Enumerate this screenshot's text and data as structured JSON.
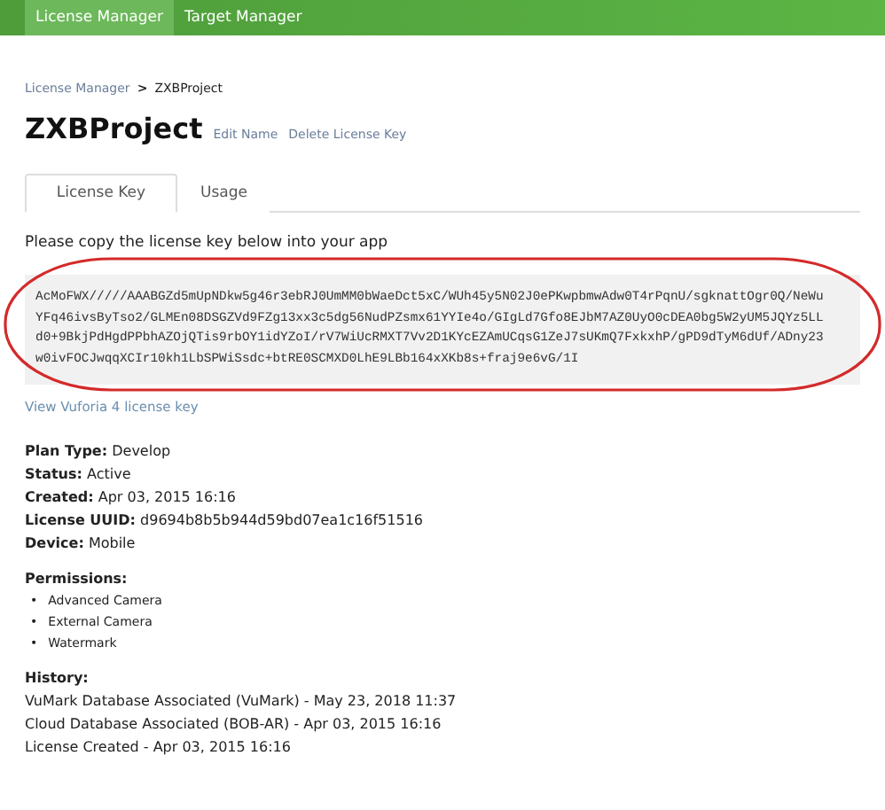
{
  "nav": [
    {
      "label": "License Manager",
      "selected": true
    },
    {
      "label": "Target Manager",
      "selected": false
    }
  ],
  "breadcrumb": [
    {
      "label": "License Manager",
      "link": true
    },
    {
      "label": "ZXBProject",
      "link": false
    }
  ],
  "breadcrumb_separator": ">",
  "title": "ZXBProject",
  "title_actions": [
    "Edit Name",
    "Delete License Key"
  ],
  "tabs": [
    {
      "label": "License Key",
      "selected": true
    },
    {
      "label": "Usage",
      "selected": false
    }
  ],
  "instruction": "Please copy the license key below into your app",
  "license_key_lines": [
    "AcMoFWX/////AAABGZd5mUpNDkw5g46r3ebRJ0UmMM0bWaeDct5xC/WUh45y5N02J0ePKwpbmwAdw0T4rPqnU/sgknattOgr0Q/NeWu",
    "YFq46ivsByTso2/GLMEn08DSGZVd9FZg13xx3c5dg56NudPZsmx61YYIe4o/GIgLd7Gfo8EJbM7AZ0UyO0cDEA0bg5W2yUM5JQYz5LL",
    "d0+9BkjPdHgdPPbhAZOjQTis9rbOY1idYZoI/rV7WiUcRMXT7Vv2D1KYcEZAmUCqsG1ZeJ7sUKmQ7FxkxhP/gPD9dTyM6dUf/ADny23",
    "w0ivFOCJwqqXCIr10kh1LbSPWiSsdc+btRE0SCMXD0LhE9LBb164xXKb8s+fraj9e6vG/1I"
  ],
  "view_link": "View Vuforia 4 license key",
  "details": [
    {
      "label": "Plan Type:",
      "value": "Develop"
    },
    {
      "label": "Status:",
      "value": "Active"
    },
    {
      "label": "Created:",
      "value": "Apr 03, 2015 16:16"
    },
    {
      "label": "License UUID:",
      "value": "d9694b8b5b944d59bd07ea1c16f51516"
    },
    {
      "label": "Device:",
      "value": "Mobile"
    }
  ],
  "permissions": {
    "heading": "Permissions:",
    "bullet": "•",
    "items": [
      "Advanced Camera",
      "External Camera",
      "Watermark"
    ]
  },
  "history": {
    "heading": "History:",
    "items": [
      "VuMark Database Associated (VuMark) - May 23, 2018 11:37",
      "Cloud Database Associated (BOB-AR) - Apr 03, 2015 16:16",
      "License Created - Apr 03, 2015 16:16"
    ]
  }
}
